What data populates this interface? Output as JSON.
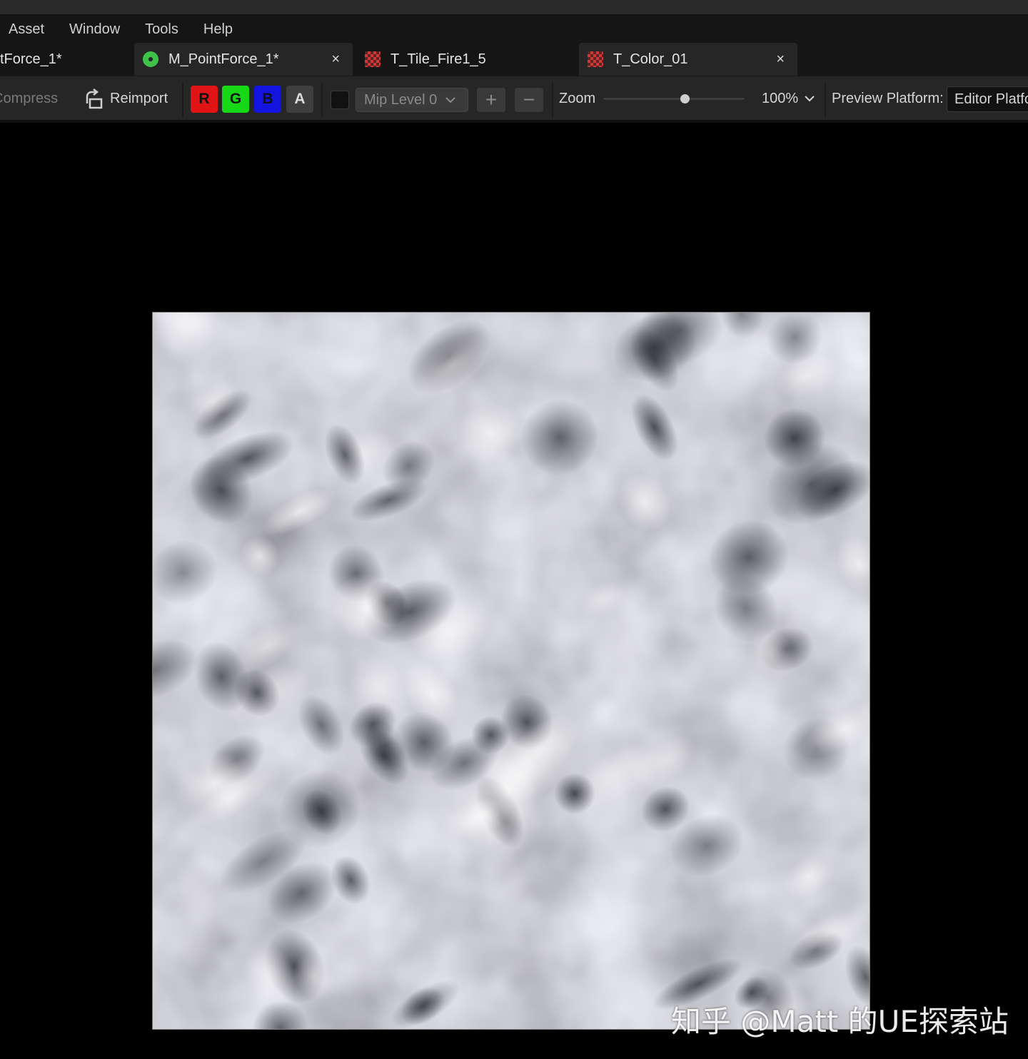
{
  "menu": {
    "items": [
      "Asset",
      "Window",
      "Tools",
      "Help"
    ]
  },
  "tabs": [
    {
      "label": "tForce_1*",
      "icon": "material-icon",
      "active": true
    },
    {
      "label": "M_PointForce_1*",
      "icon": "material-icon",
      "active": true,
      "close": "×"
    },
    {
      "label": "T_Tile_Fire1_5",
      "icon": "texture-icon",
      "active": false
    },
    {
      "label": "T_Color_01",
      "icon": "texture-icon",
      "active": true,
      "close": "×"
    }
  ],
  "toolbar": {
    "compress_label": "Compress",
    "reimport_label": "Reimport",
    "channels": {
      "r": "R",
      "g": "G",
      "b": "B",
      "a": "A"
    },
    "mip_level": "Mip Level 0",
    "plus": "+",
    "minus": "−",
    "zoom_label": "Zoom",
    "zoom_value": "100%",
    "zoom_slider_fraction": 0.58,
    "preview_platform_label": "Preview Platform:",
    "preview_platform_value": "Editor Platform"
  },
  "viewport": {
    "texture_name": "T_Color_01"
  },
  "watermark": "知乎 @Matt 的UE探索站",
  "colors": {
    "red_channel": "#e01414",
    "green_channel": "#17d817",
    "blue_channel": "#1414e0",
    "alpha_channel": "#3f3f3f",
    "material_icon": "#3ec24a",
    "texture_icon": "#d23a3a"
  }
}
